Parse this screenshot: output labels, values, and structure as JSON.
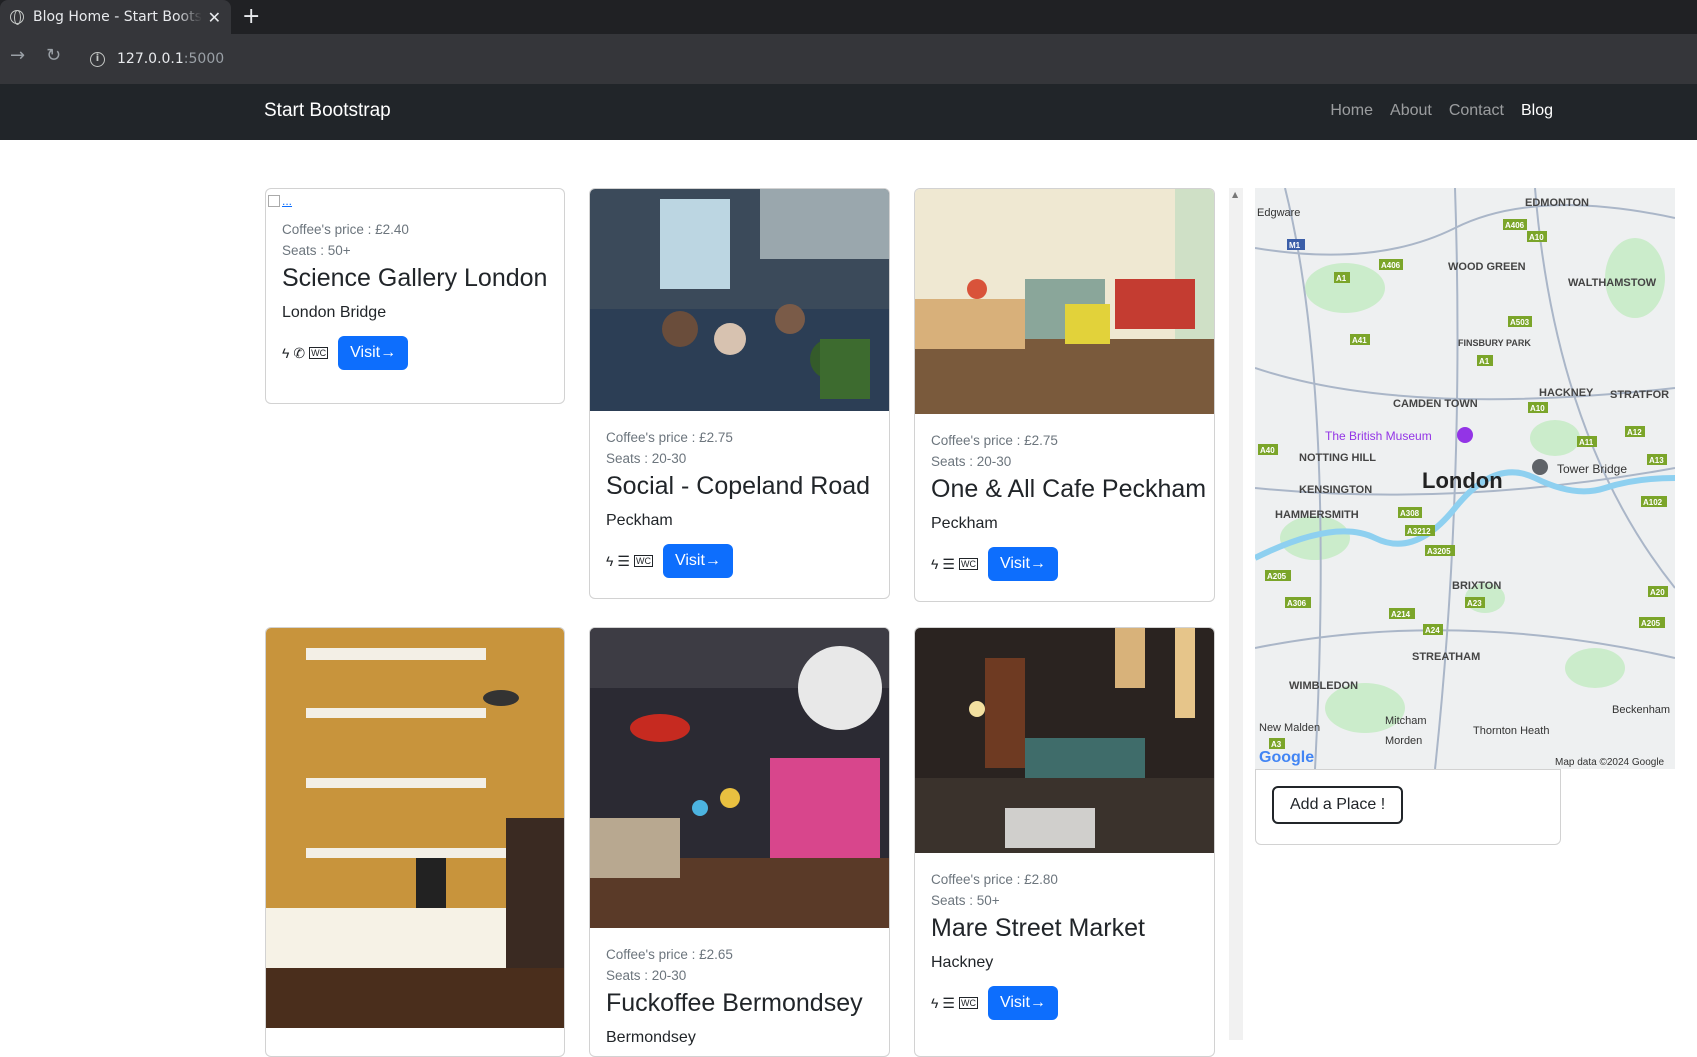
{
  "browser": {
    "tab_title": "Blog Home - Start Bootstrap",
    "url_host": "127.0.0.1",
    "url_port": ":5000"
  },
  "navbar": {
    "brand": "Start Bootstrap",
    "links": [
      "Home",
      "About",
      "Contact",
      "Blog"
    ],
    "active": "Blog"
  },
  "broken_image_alt": "...",
  "cards": [
    {
      "price": "Coffee's price : £2.40",
      "seats": "Seats : 50+",
      "name": "Science Gallery London",
      "location": "London Bridge",
      "amenities": [
        "power-icon",
        "phone-icon",
        "wc-icon"
      ],
      "visit": "Visit→"
    },
    {
      "price": "Coffee's price : £2.75",
      "seats": "Seats : 20-30",
      "name": "Social - Copeland Road",
      "location": "Peckham",
      "amenities": [
        "power-icon",
        "wifi-icon",
        "wc-icon"
      ],
      "visit": "Visit→"
    },
    {
      "price": "Coffee's price : £2.75",
      "seats": "Seats : 20-30",
      "name": "One & All Cafe Peckham",
      "location": "Peckham",
      "amenities": [
        "power-icon",
        "wifi-icon",
        "wc-icon"
      ],
      "visit": "Visit→"
    },
    {
      "price": "Coffee's price : £2.65",
      "seats": "Seats : 20-30",
      "name": "Fuckoffee Bermondsey",
      "location": "Bermondsey"
    },
    {
      "price": "Coffee's price : £2.80",
      "seats": "Seats : 50+",
      "name": "Mare Street Market",
      "location": "Hackney",
      "amenities": [
        "power-icon",
        "wifi-icon",
        "wc-icon"
      ],
      "visit": "Visit→"
    }
  ],
  "map": {
    "labels": [
      "EDMONTON",
      "Edgware",
      "WOOD GREEN",
      "WALTHAMSTOW",
      "FINSBURY PARK",
      "CAMDEN TOWN",
      "HACKNEY",
      "STRATFOR",
      "The British Museum",
      "NOTTING HILL",
      "KENSINGTON",
      "London",
      "Tower Bridge",
      "HAMMERSMITH",
      "BRIXTON",
      "STREATHAM",
      "WIMBLEDON",
      "Beckenham",
      "New Malden",
      "Mitcham",
      "Thornton Heath",
      "Morden"
    ],
    "roads": [
      "A406",
      "A10",
      "M1",
      "A406",
      "A1",
      "A503",
      "A41",
      "A1",
      "A10",
      "A40",
      "A11",
      "A12",
      "A13",
      "A102",
      "A308",
      "A3212",
      "A3205",
      "A205",
      "A306",
      "A23",
      "A214",
      "A24",
      "A20",
      "A205",
      "A3"
    ],
    "logo": "Google",
    "attribution": "Map data ©2024 Google"
  },
  "add_place": "Add a Place !"
}
